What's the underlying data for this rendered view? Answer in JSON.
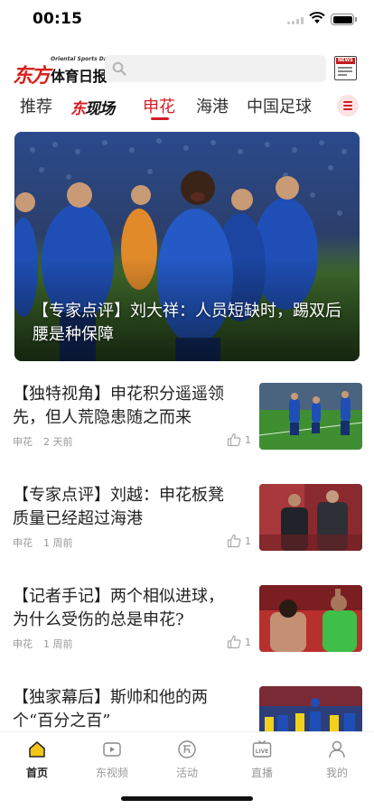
{
  "status_bar": {
    "time": "00:15"
  },
  "header": {
    "logo_red": "东方",
    "logo_black": "体育日报",
    "logo_en": "Oriental Sports Daily",
    "news_badge": "NEWS"
  },
  "nav": {
    "tabs": [
      {
        "label": "推荐",
        "active": false
      },
      {
        "label": "申花",
        "active": true
      },
      {
        "label": "海港",
        "active": false
      },
      {
        "label": "中国足球",
        "active": false
      }
    ],
    "special_red": "东",
    "special_black": "现场"
  },
  "hero": {
    "title": "【专家点评】刘大祥：人员短缺时，踢双后腰是种保障"
  },
  "articles": [
    {
      "title": "【独特视角】申花积分遥遥领先，但人荒隐患随之而来",
      "category": "申花",
      "time": "2 天前",
      "likes": "1"
    },
    {
      "title": "【专家点评】刘越：申花板凳质量已经超过海港",
      "category": "申花",
      "time": "1 周前",
      "likes": "1"
    },
    {
      "title": "【记者手记】两个相似进球，为什么受伤的总是申花?",
      "category": "申花",
      "time": "1 周前",
      "likes": "1"
    },
    {
      "title": "【独家幕后】斯帅和他的两个“百分之百”",
      "category": "",
      "time": "",
      "likes": ""
    }
  ],
  "tabbar": {
    "items": [
      {
        "label": "首页",
        "icon": "home-icon",
        "active": true
      },
      {
        "label": "东视频",
        "icon": "video-icon",
        "active": false
      },
      {
        "label": "活动",
        "icon": "activity-icon",
        "active": false
      },
      {
        "label": "直播",
        "icon": "live-icon",
        "active": false
      },
      {
        "label": "我的",
        "icon": "profile-icon",
        "active": false
      }
    ]
  },
  "colors": {
    "brand_red": "#d21c24",
    "home_yellow": "#f5c518",
    "shenhua_blue": "#1f4fb6"
  }
}
